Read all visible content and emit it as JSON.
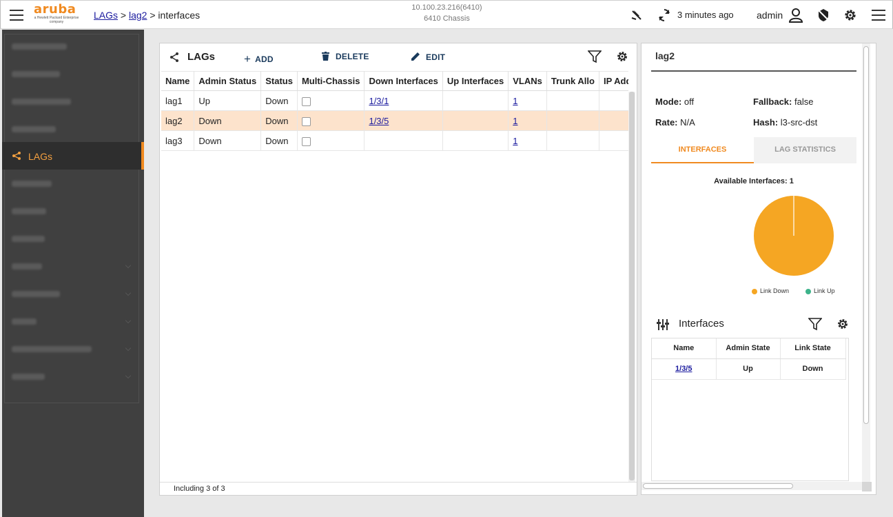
{
  "header": {
    "logo_text": "aruba",
    "logo_sub": "a Hewlett Packard Enterprise company",
    "breadcrumb": {
      "root": "LAGs",
      "sep1": ">",
      "item": "lag2",
      "sep2": ">",
      "current": "interfaces"
    },
    "device_ip": "10.100.23.216(6410)",
    "device_model": "6410 Chassis",
    "refresh_text": "3 minutes ago",
    "user": "admin"
  },
  "sidebar": {
    "active_item": "LAGs"
  },
  "lags_panel": {
    "title": "LAGs",
    "add_label": "ADD",
    "delete_label": "DELETE",
    "edit_label": "EDIT",
    "columns": [
      "Name",
      "Admin Status",
      "Status",
      "Multi-Chassis",
      "Down Interfaces",
      "Up Interfaces",
      "VLANs",
      "Trunk Allo",
      "IP Addresses"
    ],
    "rows": [
      {
        "name": "lag1",
        "admin_status": "Up",
        "status": "Down",
        "multi_chassis": false,
        "down_interfaces": "1/3/1",
        "up_interfaces": "",
        "vlans": "1",
        "trunk": "",
        "ip": ""
      },
      {
        "name": "lag2",
        "admin_status": "Down",
        "status": "Down",
        "multi_chassis": false,
        "down_interfaces": "1/3/5",
        "up_interfaces": "",
        "vlans": "1",
        "trunk": "",
        "ip": ""
      },
      {
        "name": "lag3",
        "admin_status": "Down",
        "status": "Down",
        "multi_chassis": false,
        "down_interfaces": "",
        "up_interfaces": "",
        "vlans": "1",
        "trunk": "",
        "ip": ""
      }
    ],
    "selected_row": "lag2",
    "footer": "Including 3 of 3"
  },
  "detail_panel": {
    "title": "lag2",
    "mode_label": "Mode:",
    "mode_value": "off",
    "fallback_label": "Fallback:",
    "fallback_value": "false",
    "rate_label": "Rate:",
    "rate_value": "N/A",
    "hash_label": "Hash:",
    "hash_value": "l3-src-dst",
    "tabs": [
      "INTERFACES",
      "LAG STATISTICS"
    ],
    "active_tab": "INTERFACES",
    "available_label": "Available Interfaces: 1",
    "legend": [
      "Link Down",
      "Link Up"
    ],
    "interfaces_title": "Interfaces",
    "sub_columns": [
      "Name",
      "Admin State",
      "Link State"
    ],
    "sub_rows": [
      {
        "name": "1/3/5",
        "admin_state": "Up",
        "link_state": "Down"
      }
    ]
  },
  "chart_data": {
    "type": "pie",
    "title": "Available Interfaces: 1",
    "series": [
      {
        "name": "Link Down",
        "value": 1,
        "color": "#f5a623"
      },
      {
        "name": "Link Up",
        "value": 0,
        "color": "#3db38a"
      }
    ]
  },
  "colors": {
    "accent": "#f08a20",
    "pie_down": "#f5a623",
    "pie_up": "#3db38a",
    "link": "#1a1a9e",
    "selected_row": "#fde3cc"
  }
}
